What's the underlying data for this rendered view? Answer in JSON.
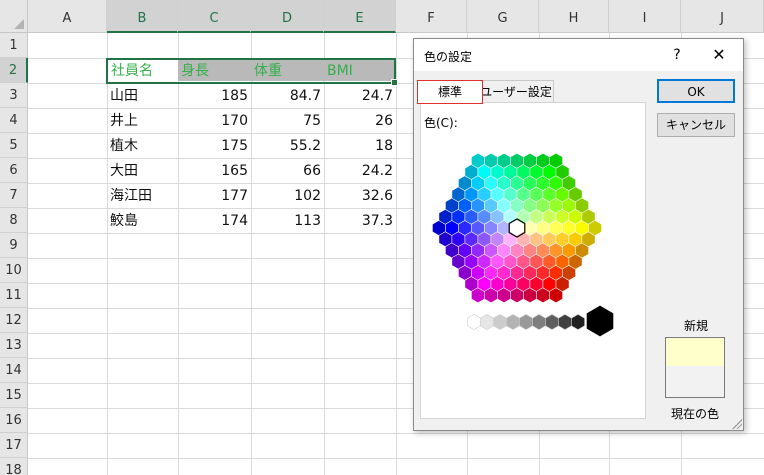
{
  "sheet": {
    "columns": [
      "A",
      "B",
      "C",
      "D",
      "E",
      "F",
      "G",
      "H",
      "I",
      "J"
    ],
    "selected_columns": [
      "B",
      "C",
      "D",
      "E"
    ],
    "rows": [
      "1",
      "2",
      "3",
      "4",
      "5",
      "6",
      "7",
      "8",
      "9",
      "10",
      "11",
      "12",
      "13",
      "14",
      "15",
      "16",
      "17",
      "18"
    ],
    "selected_row": "2",
    "header_row": [
      "社員名",
      "身長",
      "体重",
      "BMI"
    ],
    "data_rows": [
      [
        "山田",
        "185",
        "84.7",
        "24.7"
      ],
      [
        "井上",
        "170",
        "75",
        "26"
      ],
      [
        "植木",
        "175",
        "55.2",
        "18"
      ],
      [
        "大田",
        "165",
        "66",
        "24.2"
      ],
      [
        "海江田",
        "177",
        "102",
        "32.6"
      ],
      [
        "鮫島",
        "174",
        "113",
        "37.3"
      ]
    ],
    "header_text_color": "#34b04a",
    "selection_color": "#217346"
  },
  "dialog": {
    "title": "色の設定",
    "help": "?",
    "close": "✕",
    "tabs": [
      "標準",
      "ユーザー設定"
    ],
    "color_label": "色(C):",
    "ok": "OK",
    "cancel": "キャンセル",
    "new_label": "新規",
    "current_label": "現在の色",
    "new_color": "#ffffcc",
    "current_color": "#f2f2f2",
    "active_tab_border": "#e0302a"
  }
}
